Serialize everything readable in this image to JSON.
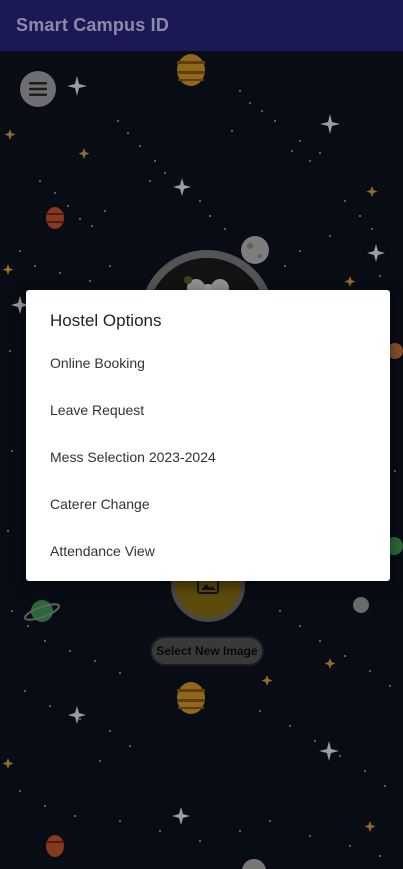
{
  "app": {
    "title": "Smart Campus ID"
  },
  "dialog": {
    "title": "Hostel Options",
    "options": [
      "Online Booking",
      "Leave Request",
      "Mess Selection 2023-2024",
      "Caterer Change",
      "Attendance View"
    ]
  },
  "buttons": {
    "select_image": "Select New Image"
  },
  "colors": {
    "appbar": "#1a1955",
    "background": "#0b1320",
    "dialog": "#ffffff",
    "accent_orange": "#d79a2b"
  },
  "icons": [
    "menu-icon",
    "image-icon"
  ]
}
